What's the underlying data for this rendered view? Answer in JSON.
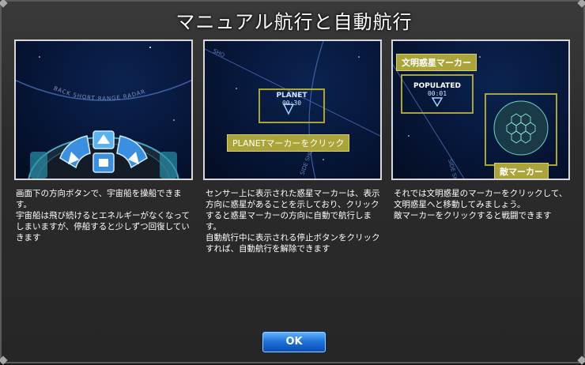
{
  "dialog": {
    "title": "マニュアル航行と自動航行"
  },
  "panel1": {
    "radar_text": "BACK SHORT RANGE RADAR",
    "icons": [
      "arrow-up-icon",
      "arrow-down-left-icon",
      "arrow-down-right-icon",
      "stop-icon"
    ],
    "desc": [
      "画面下の方向ボタンで、宇宙船を操船できます。",
      "宇宙船は飛び続けるとエネルギーがなくなってしまいますが、停船すると少しずつ回復していきます"
    ]
  },
  "panel2": {
    "marker_name": "PLANET",
    "marker_time": "00:30",
    "callout": "PLANETマーカーをクリック",
    "radar_text": "SIDE SHORT",
    "desc": [
      "センサー上に表示された惑星マーカーは、表示方向に惑星があることを示しており、クリックすると惑星マーカーの方向に自動で航行します。",
      "自動航行中に表示される停止ボタンをクリックすれば、自動航行を解除できます"
    ]
  },
  "panel3": {
    "label_top": "文明惑星マーカー",
    "marker_name": "POPULATED",
    "marker_time": "00:01",
    "enemy_label": "敵マーカー",
    "radar_text": "SIDE SHORT RA",
    "desc": [
      "それでは文明惑星のマーカーをクリックして、文明惑星へと移動してみましょう。",
      "敵マーカーをクリックすると戦闘できます"
    ]
  },
  "ok_label": "OK"
}
